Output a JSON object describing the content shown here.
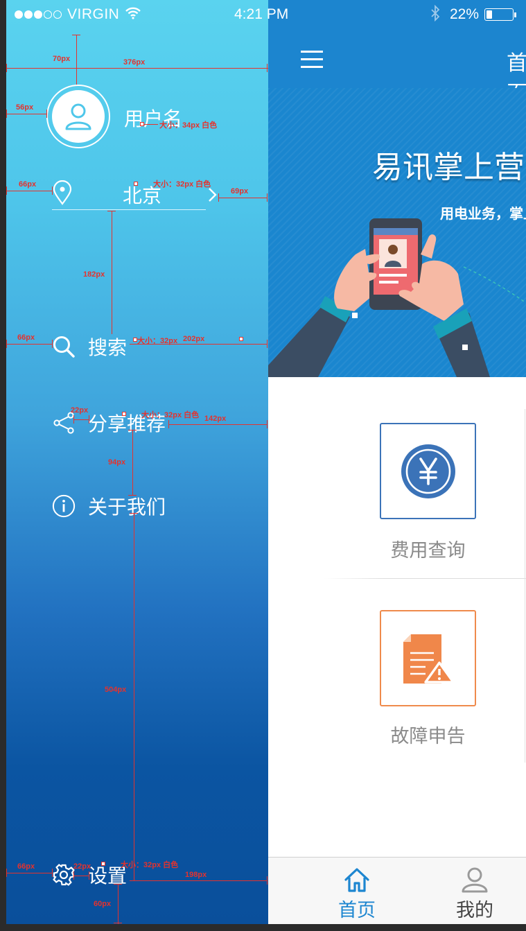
{
  "status_bar": {
    "carrier": "VIRGIN",
    "time": "4:21 PM",
    "battery": "22%",
    "battery_level": 0.22
  },
  "drawer": {
    "username": "用户名",
    "city": "北京",
    "menu": [
      {
        "label": "搜索",
        "icon": "search-icon"
      },
      {
        "label": "分享推荐",
        "icon": "share-icon"
      },
      {
        "label": "关于我们",
        "icon": "info-icon"
      },
      {
        "label": "设置",
        "icon": "gear-icon"
      }
    ]
  },
  "annotations": {
    "top_70": "70px",
    "width_376": "376px",
    "avatar_left_56": "56px",
    "username_spec": "大小：34px 白色",
    "city_spec": "大小：32px 白色",
    "city_left_66": "66px",
    "city_right_69": "69px",
    "gap_182": "182px",
    "search_left_66": "66px",
    "search_spec": "大小：32px",
    "search_right_202": "202px",
    "share_gap_22": "22px",
    "share_spec": "大小：32px 白色",
    "share_right_142": "142px",
    "gap_94": "94px",
    "gap_504": "504px",
    "settings_left_66": "66px",
    "settings_gap_22": "22px",
    "settings_spec": "大小：32px 白色",
    "settings_right_198": "198px",
    "bottom_60": "60px"
  },
  "main": {
    "title": "首页",
    "banner_title": "易讯掌上营业厅",
    "banner_subtitle": "用电业务，掌上办理",
    "tiles": [
      {
        "label": "费用查询",
        "icon": "yen-icon",
        "color": "#3b73b8"
      },
      {
        "label": "故障申告",
        "icon": "fault-report-icon",
        "color": "#ef8a4b"
      }
    ]
  },
  "tabbar": {
    "tabs": [
      {
        "label": "首页",
        "icon": "home-icon",
        "active": true
      },
      {
        "label": "我的",
        "icon": "user-icon",
        "active": false
      }
    ]
  },
  "colors": {
    "accent": "#1c85cf",
    "annotation": "#e5322d",
    "tile_blue": "#3b73b8",
    "tile_orange": "#ef8a4b"
  }
}
